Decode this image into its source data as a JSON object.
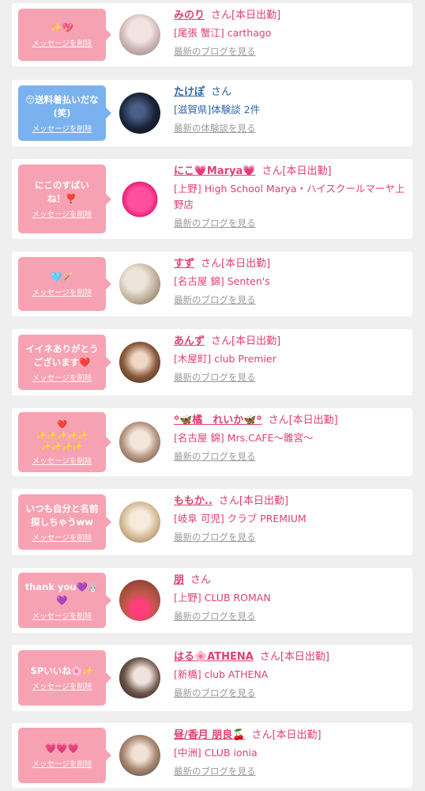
{
  "items": [
    {
      "message": "✨💖",
      "delete_label": "メッセージを削除",
      "name": "みのり",
      "honorific": "さん[本日出勤]",
      "shop": "[尾張 蟹江] carthago",
      "link": "最新のブログを見る",
      "bubble_color": "#f7a2b2"
    },
    {
      "message": "😚送料着払いだな\n(笑)",
      "delete_label": "メッセージを削除",
      "name": "たけぽ",
      "honorific": "さん",
      "shop": "[滋賀県]体験談 2件",
      "link": "最新の体験談を見る",
      "bubble_color": "#7ab2f0"
    },
    {
      "message": "にこのすばい\nね！❣️",
      "delete_label": "メッセージを削除",
      "name": "にこ💗Marya💗",
      "honorific": "さん[本日出勤]",
      "shop": "[上野] High School Marya・ハイスクールマーヤ上野店",
      "link": "最新のブログを見る",
      "bubble_color": "#f7a2b2"
    },
    {
      "message": "🩵🪄",
      "delete_label": "メッセージを削除",
      "name": "すず",
      "honorific": "さん[本日出勤]",
      "shop": "[名古屋 錦] Senten's",
      "link": "最新のブログを見る",
      "bubble_color": "#f7a2b2"
    },
    {
      "message": "イイネありがとう\nございます❤️",
      "delete_label": "メッセージを削除",
      "name": "あんず",
      "honorific": "さん[本日出勤]",
      "shop": "[木屋町] club Premier",
      "link": "最新のブログを見る",
      "bubble_color": "#f7a2b2"
    },
    {
      "message": "❤️\n✨✨✨✨✨\n✨✨✨✨",
      "delete_label": "メッセージを削除",
      "name": "꙳🦋橘　れいか🦋꙳",
      "honorific": "さん[本日出勤]",
      "shop": "[名古屋 錦] Mrs.CAFE〜雛宮〜",
      "link": "最新のブログを見る",
      "bubble_color": "#f7a2b2"
    },
    {
      "message": "いつも自分と名前\n探しちゃうww",
      "delete_label": "メッセージを削除",
      "name": "ももか..",
      "honorific": "さん[本日出勤]",
      "shop": "[岐阜 可児] クラブ PREMIUM",
      "link": "最新のブログを見る",
      "bubble_color": "#f7a2b2"
    },
    {
      "message": "thank you💜🐰\n💜",
      "delete_label": "メッセージを削除",
      "name": "朋",
      "honorific": "さん",
      "shop": "[上野] CLUB ROMAN",
      "link": "最新のブログを見る",
      "bubble_color": "#f7a2b2"
    },
    {
      "message": "SPいいね🌸✨",
      "delete_label": "メッセージを削除",
      "name": "はる🌸ATHENA",
      "honorific": "さん[本日出勤]",
      "shop": "[新橋] club ATHENA",
      "link": "最新のブログを見る",
      "bubble_color": "#f7a2b2"
    },
    {
      "message": "💗💗💗",
      "delete_label": "メッセージを削除",
      "name": "昼/香月 朋良🍒",
      "honorific": "さん[本日出勤]",
      "shop": "[中洲] CLUB ionia",
      "link": "最新のブログを見る",
      "bubble_color": "#f7a2b2"
    }
  ]
}
